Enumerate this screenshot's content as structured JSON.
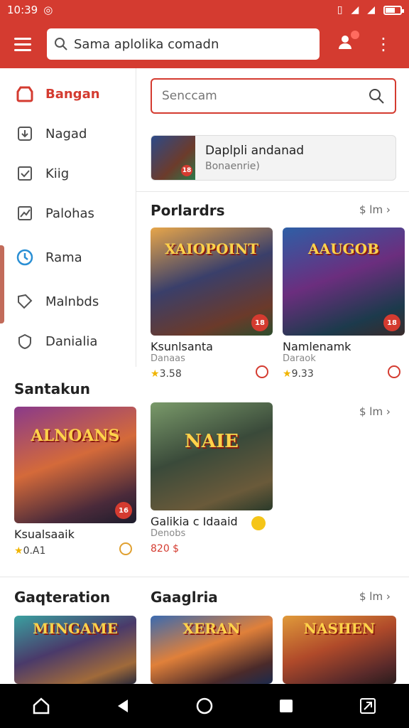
{
  "status": {
    "time": "10:39"
  },
  "appbar": {
    "search_value": "Sama aplolika comadn"
  },
  "sidebar": {
    "items": [
      {
        "label": "Bangan",
        "icon": "shop-icon",
        "active": true
      },
      {
        "label": "Nagad",
        "icon": "download-icon"
      },
      {
        "label": "Kiig",
        "icon": "check-box-icon"
      },
      {
        "label": "Palohas",
        "icon": "chart-icon"
      },
      {
        "label": "Rama",
        "icon": "clock-icon"
      },
      {
        "label": "Malnbds",
        "icon": "tag-icon"
      },
      {
        "label": "Danialia",
        "icon": "shield-icon"
      }
    ]
  },
  "main_search": {
    "placeholder": "Senccam"
  },
  "promo": {
    "title": "Daplpli andanad",
    "subtitle": "Bonaenrie)",
    "badge": "18"
  },
  "sections": {
    "s1": {
      "title": "Porlardrs",
      "more": "$ lm"
    },
    "s2": {
      "title": "Santakun",
      "more": "$ lm"
    },
    "s3": {
      "title": "Gaqteration"
    },
    "s4": {
      "title": "Gaaglria",
      "more": "$ lm"
    }
  },
  "cards": {
    "c1": {
      "name": "Ksunlsanta",
      "sub": "Danaas",
      "rating": "3.58",
      "badge": "18",
      "logo": "XAIOPOINT"
    },
    "c2": {
      "name": "Namlenamk",
      "sub": "Daraok",
      "rating": "9.33",
      "badge": "18",
      "logo": "AAUGOB"
    },
    "c3": {
      "name": "Ksualsaaik",
      "sub": "",
      "rating": "0.A1",
      "badge": "16",
      "logo": "ALNOANS"
    },
    "c4": {
      "name": "Galikia c Idaaid",
      "sub": "Denobs",
      "price": "820 $",
      "logo": "NAIE"
    },
    "c5": {
      "logo": "MINGAME"
    },
    "c6": {
      "logo": "XERAN"
    },
    "c7": {
      "logo": "NASHEN"
    }
  }
}
